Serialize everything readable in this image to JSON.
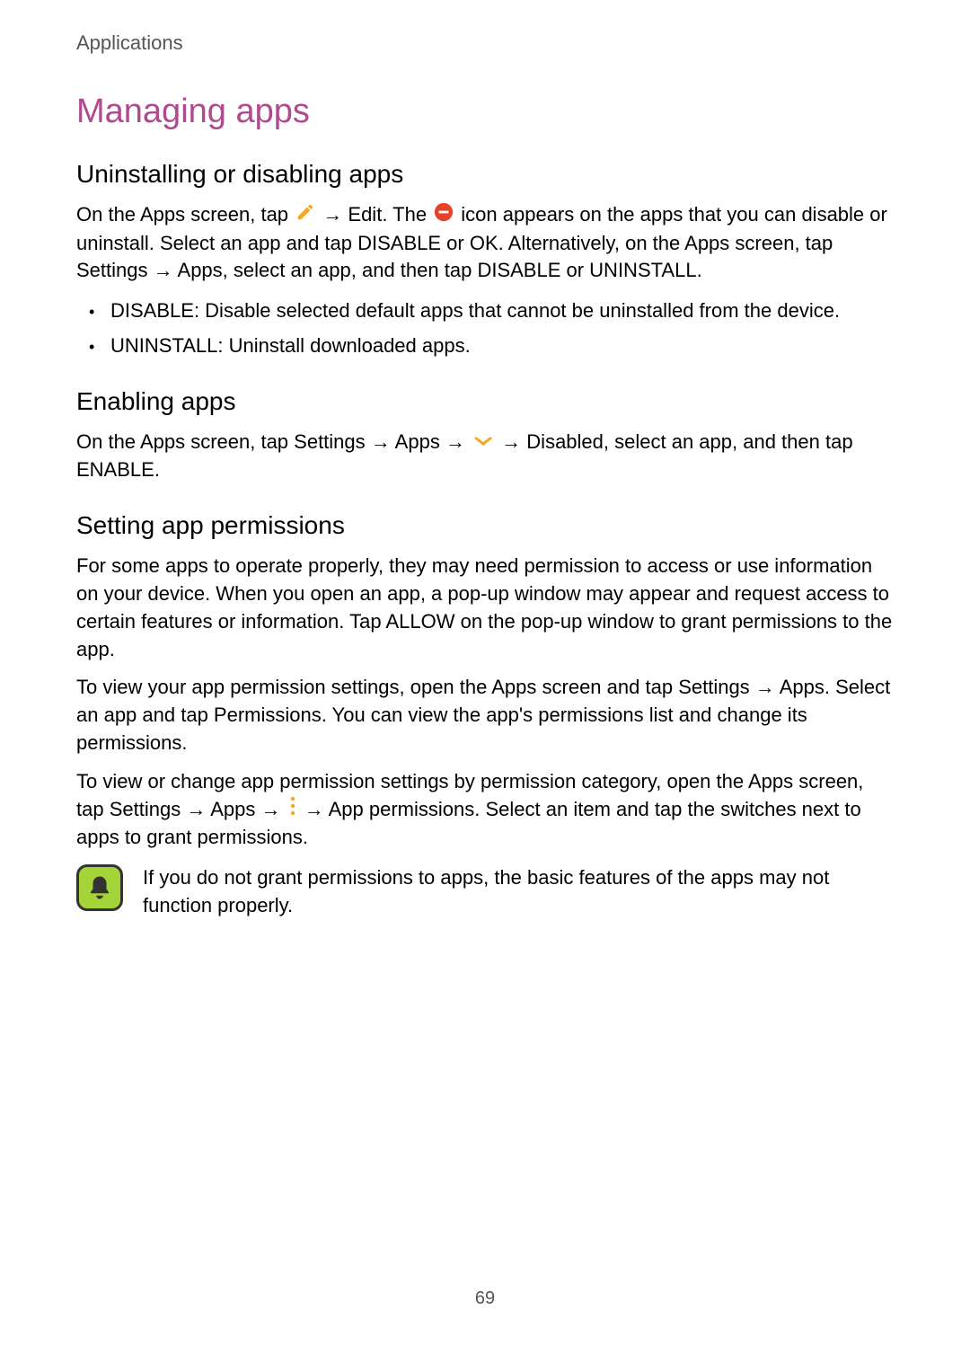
{
  "header": {
    "breadcrumb": "Applications"
  },
  "title": "Managing apps",
  "section1": {
    "heading": "Uninstalling or disabling apps",
    "p1_a": "On the Apps screen, tap ",
    "p1_b": " → ",
    "p1_edit": "Edit",
    "p1_c": ". The ",
    "p1_d": " icon appears on the apps that you can disable or uninstall. Select an app and tap ",
    "p1_disable": "DISABLE",
    "p1_e": " or ",
    "p1_ok": "OK",
    "p1_f": ". Alternatively, on the Apps screen, tap ",
    "p1_settings": "Settings",
    "p1_g": " → ",
    "p1_apps": "Apps",
    "p1_h": ", select an app, and then tap ",
    "p1_disable2": "DISABLE",
    "p1_i": " or ",
    "p1_uninstall": "UNINSTALL",
    "p1_j": ".",
    "bullet1_label": "DISABLE",
    "bullet1_text": ": Disable selected default apps that cannot be uninstalled from the device.",
    "bullet2_label": "UNINSTALL",
    "bullet2_text": ": Uninstall downloaded apps."
  },
  "section2": {
    "heading": "Enabling apps",
    "p1_a": "On the Apps screen, tap ",
    "p1_settings": "Settings",
    "p1_b": " → ",
    "p1_apps": "Apps",
    "p1_c": " → ",
    "p1_d": " → ",
    "p1_disabled": "Disabled",
    "p1_e": ", select an app, and then tap ",
    "p1_enable": "ENABLE",
    "p1_f": "."
  },
  "section3": {
    "heading": "Setting app permissions",
    "p1": "For some apps to operate properly, they may need permission to access or use information on your device. When you open an app, a pop-up window may appear and request access to certain features or information. Tap ",
    "p1_allow": "ALLOW",
    "p1_b": " on the pop-up window to grant permissions to the app.",
    "p2_a": "To view your app permission settings, open the Apps screen and tap ",
    "p2_settings": "Settings",
    "p2_b": " → ",
    "p2_apps": "Apps",
    "p2_c": ". Select an app and tap ",
    "p2_permissions": "Permissions",
    "p2_d": ". You can view the app's permissions list and change its permissions.",
    "p3_a": "To view or change app permission settings by permission category, open the Apps screen, tap ",
    "p3_settings": "Settings",
    "p3_b": " → ",
    "p3_apps": "Apps",
    "p3_c": " → ",
    "p3_d": " → ",
    "p3_appperm": "App permissions",
    "p3_e": ". Select an item and tap the switches next to apps to grant permissions.",
    "note": "If you do not grant permissions to apps, the basic features of the apps may not function properly."
  },
  "page_number": "69"
}
